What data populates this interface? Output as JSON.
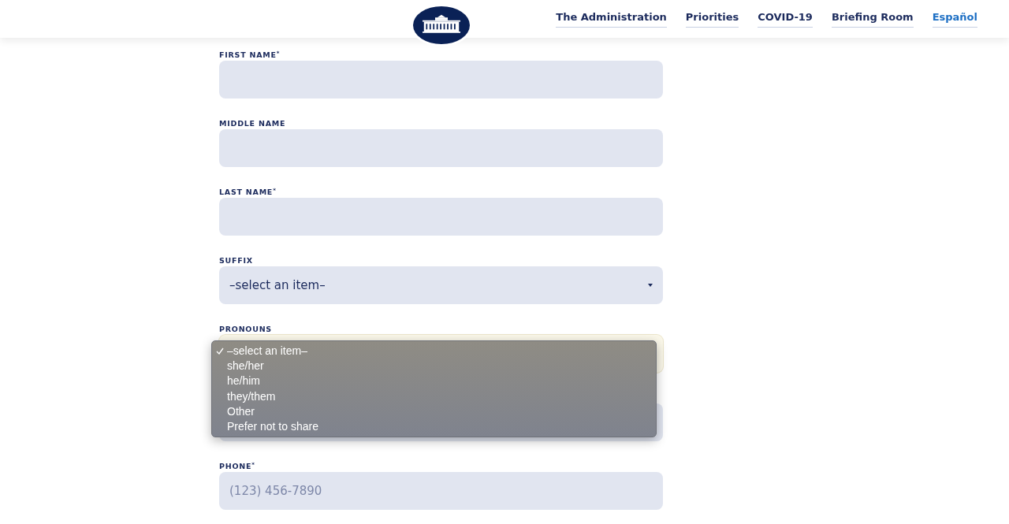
{
  "nav": {
    "items": [
      {
        "label": "The Administration",
        "kind": "link"
      },
      {
        "label": "Priorities",
        "kind": "link"
      },
      {
        "label": "COVID-19",
        "kind": "link"
      },
      {
        "label": "Briefing Room",
        "kind": "link"
      },
      {
        "label": "Español",
        "kind": "language"
      }
    ]
  },
  "form": {
    "fields": [
      {
        "kind": "input",
        "label": "FIRST NAME$^{*}$",
        "focused": false
      },
      {
        "kind": "input",
        "label": "MIDDLE NAME",
        "focused": false
      },
      {
        "kind": "input",
        "label": "LAST NAME$^{*}$",
        "focused": false
      },
      {
        "kind": "select",
        "label": "SUFFIX",
        "value": "–select an item–",
        "focused": false
      },
      {
        "kind": "select",
        "label": "PRONOUNS",
        "focused": true,
        "dropdown": {
          "options": [
            {
              "label": "–select an item–",
              "selected": true
            },
            {
              "label": "she/her",
              "selected": false
            },
            {
              "label": "he/him",
              "selected": false
            },
            {
              "label": "they/them",
              "selected": false
            },
            {
              "label": "Other",
              "selected": false
            },
            {
              "label": "Prefer not to share",
              "selected": false
            }
          ]
        }
      },
      {
        "kind": "input",
        "focused": false
      },
      {
        "kind": "input",
        "label": "PHONE$^{*}$",
        "placeholder": "(123) 456-7890",
        "focused": false
      }
    ]
  }
}
